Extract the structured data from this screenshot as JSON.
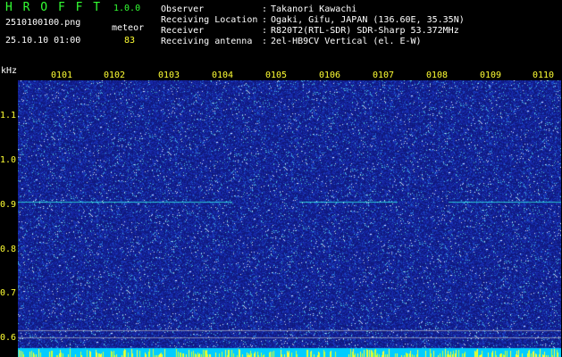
{
  "header": {
    "app_name": "H R O F F T",
    "version": "1.0.0",
    "filename": "2510100100.png",
    "datetime": "25.10.10 01:00",
    "meteor_label": "meteor",
    "meteor_count": "83"
  },
  "info": {
    "labels": [
      "Observer",
      "Receiving Location",
      "Receiver",
      "Receiving antenna"
    ],
    "colons": [
      ":",
      ":",
      ":",
      ":"
    ],
    "values": [
      "Takanori Kawachi",
      "Ogaki, Gifu, JAPAN (136.60E, 35.35N)",
      "R820T2(RTL-SDR) SDR-Sharp 53.372MHz",
      "2el-HB9CV Vertical (el. E-W)"
    ]
  },
  "axis": {
    "y_unit": "kHz",
    "y_ticks": [
      "1.1",
      "1.0",
      "0.9",
      "0.8",
      "0.7",
      "0.6"
    ],
    "x_ticks": [
      "0101",
      "0102",
      "0103",
      "0104",
      "0105",
      "0106",
      "0107",
      "0108",
      "0109",
      "0110"
    ]
  },
  "colors": {
    "background": "#000000",
    "waterfall_base": "#1a2a9a",
    "signal_line": "#33ffee",
    "header_green": "#33ff33",
    "tick_yellow": "#ffff33"
  }
}
